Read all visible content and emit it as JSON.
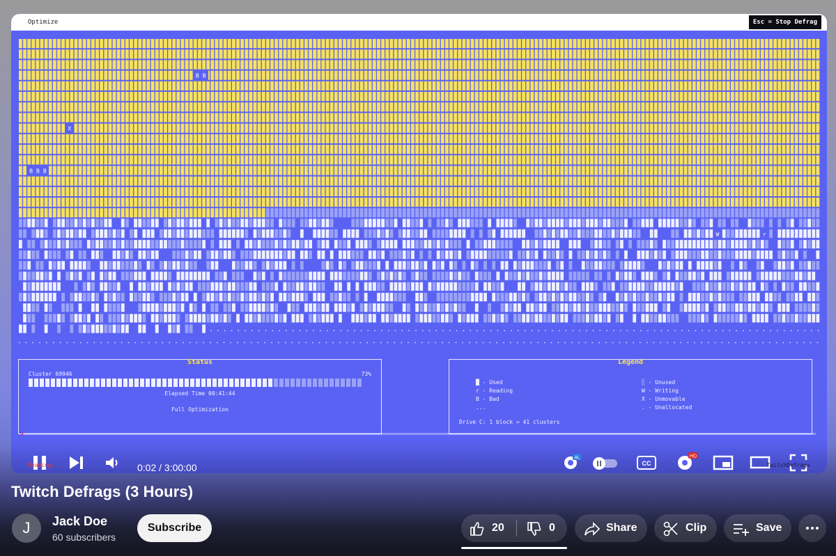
{
  "defrag": {
    "menu_label": "Optimize",
    "stop_hint": "Esc = Stop Defrag",
    "grid": {
      "colors": {
        "used": "#f8e25a",
        "background": "#5a62f4",
        "unused": "#9aa2f6",
        "white": "#eef0ff",
        "dot": "#dde0ff"
      },
      "markers": [
        "B",
        "B",
        "X",
        "B",
        "B",
        "B",
        "W",
        "r"
      ]
    },
    "status": {
      "title": "Status",
      "cluster": "Cluster 69946",
      "percent": "73%",
      "progress": 0.73,
      "elapsed": "Elapsed Time 00:41:44",
      "mode": "Full Optimization"
    },
    "legend": {
      "title": "Legend",
      "items": [
        {
          "symbol": "█",
          "label": "- Used"
        },
        {
          "symbol": "r",
          "label": "- Reading"
        },
        {
          "symbol": "B",
          "label": "- Bad"
        },
        {
          "symbol": "...",
          "label": ""
        },
        {
          "symbol": "░",
          "label": "- Unused"
        },
        {
          "symbol": "W",
          "label": "- Writing"
        },
        {
          "symbol": "X",
          "label": "- Unmovable"
        },
        {
          "symbol": ".",
          "label": "- Unallocated"
        }
      ],
      "drive_info": "Drive C: 1 block = 41 clusters"
    },
    "reading_text": "Reading...",
    "watermark": "TwitchDefrags"
  },
  "player": {
    "time": "0:02 / 3:00:00",
    "icons": [
      "pause-icon",
      "next-icon",
      "volume-icon",
      "autoplay-icon",
      "autoplay-toggle",
      "captions-icon",
      "settings-icon",
      "miniplayer-icon",
      "theater-icon",
      "fullscreen-icon"
    ],
    "autoplay_badge": "AL",
    "hd_badge": "HD",
    "cc_label": "CC",
    "played_fraction": 0.0002
  },
  "video": {
    "title": "Twitch Defrags (3 Hours)",
    "channel": {
      "name": "Jack Doe",
      "subscribers": "60 subscribers",
      "avatar_letter": "J"
    },
    "subscribe_label": "Subscribe",
    "likes": "20",
    "dislikes": "0",
    "share_label": "Share",
    "clip_label": "Clip",
    "save_label": "Save"
  }
}
